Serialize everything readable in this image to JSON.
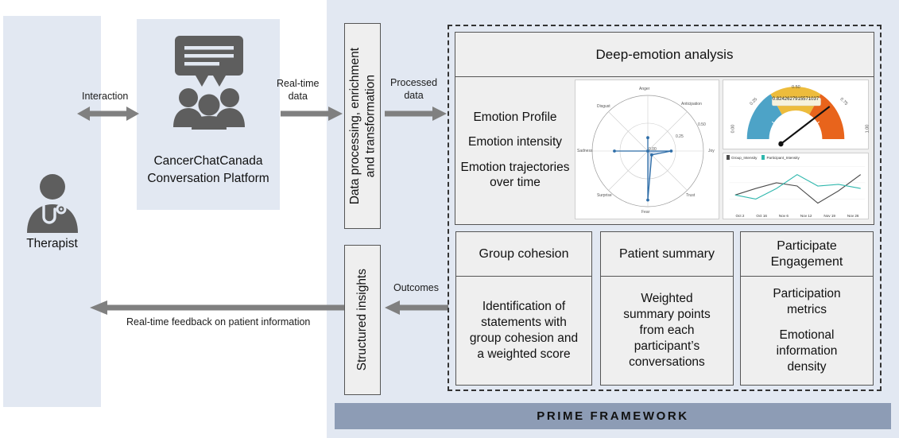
{
  "flow": {
    "therapist_label": "Therapist",
    "platform_label": "CancerChatCanada\nConversation Platform",
    "interaction_label": "Interaction",
    "realtime_data_label": "Real-time\ndata",
    "processed_data_label": "Processed\ndata",
    "outcomes_label": "Outcomes",
    "feedback_label": "Real-time feedback on patient information",
    "processing_box_label": "Data processing, enrichment\nand transformation",
    "insights_box_label": "Structured insights"
  },
  "analysis": {
    "header": "Deep-emotion analysis",
    "features": [
      "Emotion Profile",
      "Emotion intensity",
      "Emotion\ntrajectories over\ntime"
    ]
  },
  "cards": [
    {
      "title": "Group cohesion",
      "body": "Identification of\nstatements with\ngroup cohesion and\na weighted score"
    },
    {
      "title": "Patient summary",
      "body": "Weighted\nsummary points\nfrom each\nparticipant’s\nconversations"
    },
    {
      "title": "Participate\nEngagement",
      "body_1": "Participation\nmetrics",
      "body_2": "Emotional\ninformation\ndensity"
    }
  ],
  "footer": {
    "prime_label": "PRIME FRAMEWORK"
  },
  "colors": {
    "panel_blue": "#e2e8f2",
    "box_grey": "#efefef",
    "arrow_grey": "#808080",
    "prime_bar": "#8d9cb5",
    "icon_grey": "#5e5e5e",
    "radar_blue": "#4a7ebb",
    "gauge_teal": "#4da3c7",
    "gauge_yellow": "#edbc3c",
    "gauge_orange": "#e8641c",
    "line_dark": "#4a4a4a",
    "line_teal": "#2fb7ad"
  },
  "chart_data": [
    {
      "type": "radar",
      "title": "",
      "categories": [
        "Anger",
        "Anticipation",
        "Joy",
        "Trust",
        "Fear",
        "Surprise",
        "Sadness",
        "Disgust"
      ],
      "values": [
        0.12,
        0.0,
        0.21,
        0.05,
        0.44,
        0.0,
        0.3,
        0.0
      ],
      "tick_labels": [
        "0.00",
        "0.25",
        "0.50"
      ],
      "rlim": [
        0,
        0.5
      ],
      "grid": true,
      "legend": "none"
    },
    {
      "type": "gauge",
      "value": 0.8242627915571037,
      "value_label": "0.8242627915571037",
      "tick_labels": [
        "0.00",
        "0.25",
        "0.50",
        "0.75",
        "1.00"
      ],
      "range": [
        0,
        1
      ],
      "bands": [
        {
          "from": 0.0,
          "to": 0.33,
          "color": "#4da3c7"
        },
        {
          "from": 0.33,
          "to": 0.66,
          "color": "#edbc3c"
        },
        {
          "from": 0.66,
          "to": 1.0,
          "color": "#e8641c"
        }
      ]
    },
    {
      "type": "line",
      "title": "",
      "xlabel": "",
      "ylabel": "",
      "x": [
        "Oct 2",
        "Oct 16",
        "Nov 6",
        "Nov 12",
        "Nov 19",
        "Nov 26"
      ],
      "ylim": [
        0.5,
        1.0
      ],
      "legend": [
        "Group_Intensity",
        "Participant_Intensity"
      ],
      "legend_position": "top-left",
      "grid": false,
      "series": [
        {
          "name": "Group_Intensity",
          "color": "#4a4a4a",
          "values": [
            0.74,
            0.79,
            0.83,
            0.8,
            0.67,
            0.77,
            0.88
          ],
          "point_labels": [
            "0.74",
            "0.79",
            "0.83",
            "0.80",
            "0.67",
            "0.77",
            "0.88"
          ]
        },
        {
          "name": "Participant_Intensity",
          "color": "#2fb7ad",
          "values": [
            0.74,
            0.71,
            0.79,
            0.88,
            0.8,
            0.81,
            0.79
          ],
          "point_labels": [
            "0.74",
            "0.71",
            "0.79",
            "0.88",
            "0.80",
            "0.81",
            "0.79"
          ]
        }
      ]
    }
  ]
}
